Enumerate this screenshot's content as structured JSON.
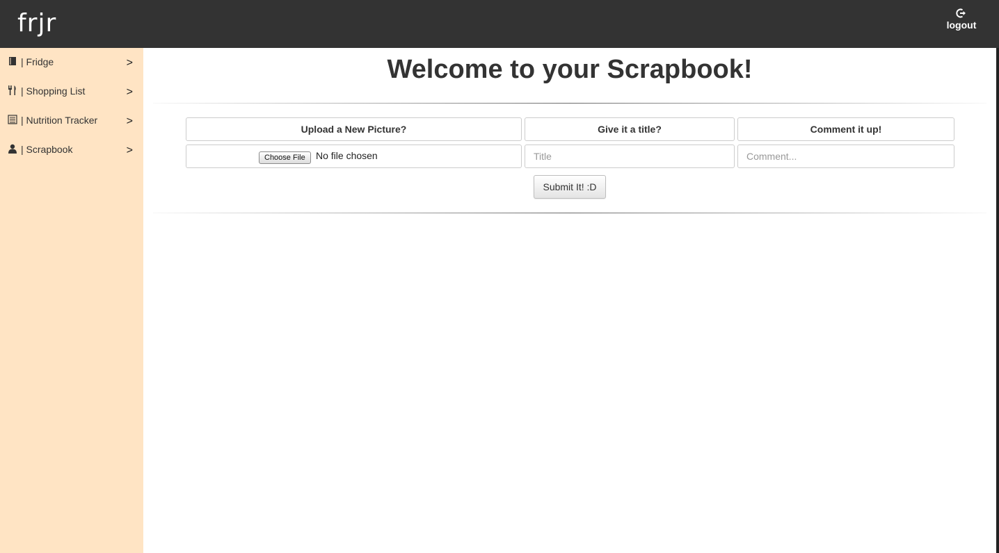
{
  "header": {
    "brand": "frjr",
    "logout": {
      "label": "logout",
      "icon": "logout-icon"
    }
  },
  "sidebar": {
    "items": [
      {
        "label": "| Fridge",
        "icon": "book-icon",
        "chevron": ">"
      },
      {
        "label": "| Shopping List",
        "icon": "cutlery-icon",
        "chevron": ">"
      },
      {
        "label": "| Nutrition Tracker",
        "icon": "list-icon",
        "chevron": ">"
      },
      {
        "label": "| Scrapbook",
        "icon": "user-icon",
        "chevron": ">"
      }
    ]
  },
  "main": {
    "title": "Welcome to your Scrapbook!",
    "form": {
      "headers": [
        "Upload a New Picture?",
        "Give it a title?",
        "Comment it up!"
      ],
      "file_button": "Choose File",
      "file_status": "No file chosen",
      "title_placeholder": "Title",
      "title_value": "",
      "comment_placeholder": "Comment...",
      "comment_value": "",
      "submit_label": "Submit It! :D"
    }
  },
  "colors": {
    "topbar": "#333333",
    "sidebar": "#ffe4c4",
    "text": "#333333"
  }
}
